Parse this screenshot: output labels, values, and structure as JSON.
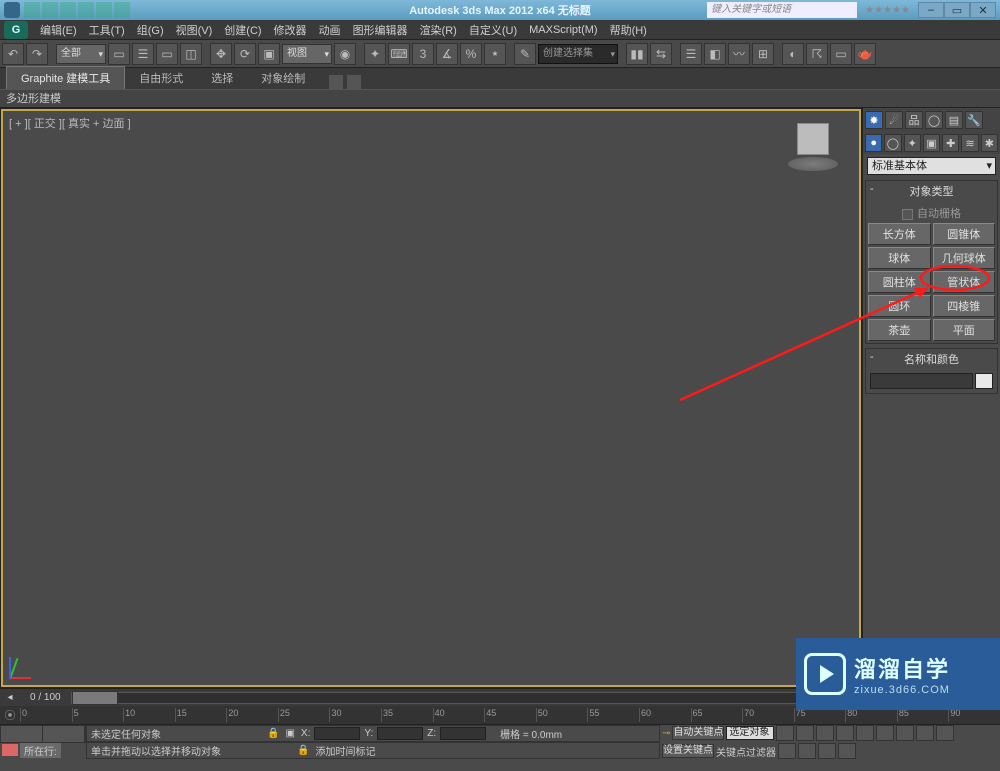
{
  "title": "Autodesk 3ds Max 2012 x64   无标题",
  "search_placeholder": "键入关键字或短语",
  "menus": [
    "编辑(E)",
    "工具(T)",
    "组(G)",
    "视图(V)",
    "创建(C)",
    "修改器",
    "动画",
    "图形编辑器",
    "渲染(R)",
    "自定义(U)",
    "MAXScript(M)",
    "帮助(H)"
  ],
  "toolbar": {
    "selection_set": "全部",
    "view_dd": "视图",
    "create_sel_set": "创建选择集"
  },
  "ribbon": {
    "tabs": [
      "Graphite 建模工具",
      "自由形式",
      "选择",
      "对象绘制"
    ],
    "sub": "多边形建模"
  },
  "viewport": {
    "label": "[ + ][ 正交 ][ 真实 + 边面 ]"
  },
  "cmdpanel": {
    "category": "标准基本体",
    "rollout_type": "对象类型",
    "autogrid": "自动栅格",
    "buttons": [
      [
        "长方体",
        "圆锥体"
      ],
      [
        "球体",
        "几何球体"
      ],
      [
        "圆柱体",
        "管状体"
      ],
      [
        "圆环",
        "四棱锥"
      ],
      [
        "茶壶",
        "平面"
      ]
    ],
    "rollout_name": "名称和颜色"
  },
  "timeslider": {
    "pos": "0 / 100"
  },
  "trackbar_ticks": [
    "0",
    "5",
    "10",
    "15",
    "20",
    "25",
    "30",
    "35",
    "40",
    "45",
    "50",
    "55",
    "60",
    "65",
    "70",
    "75",
    "80",
    "85",
    "90"
  ],
  "status": {
    "line1_left": "未选定任何对象",
    "x": "X:",
    "y": "Y:",
    "z": "Z:",
    "grid": "栅格 = 0.0mm",
    "autokey": "自动关键点",
    "sel_set_label": "选定对象",
    "setkey": "设置关键点",
    "keyfilter": "关键点过滤器",
    "line2_left": "单击并拖动以选择并移动对象",
    "addtime": "添加时间标记",
    "nowplay": "所在行:"
  },
  "watermark": {
    "brand": "溜溜自学",
    "url": "zixue.3d66.COM"
  }
}
